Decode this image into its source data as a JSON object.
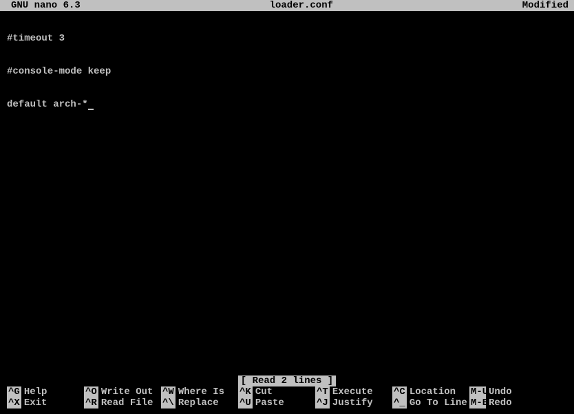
{
  "titlebar": {
    "app": "GNU nano 6.3",
    "filename": "loader.conf",
    "status": "Modified"
  },
  "editor": {
    "lines": [
      "#timeout 3",
      "#console-mode keep",
      "default arch-*"
    ]
  },
  "status": "[ Read 2 lines ]",
  "help": {
    "row1": [
      {
        "key": "^G",
        "label": "Help"
      },
      {
        "key": "^O",
        "label": "Write Out"
      },
      {
        "key": "^W",
        "label": "Where Is"
      },
      {
        "key": "^K",
        "label": "Cut"
      },
      {
        "key": "^T",
        "label": "Execute"
      },
      {
        "key": "^C",
        "label": "Location"
      },
      {
        "key": "M-U",
        "label": "Undo"
      }
    ],
    "row2": [
      {
        "key": "^X",
        "label": "Exit"
      },
      {
        "key": "^R",
        "label": "Read File"
      },
      {
        "key": "^\\",
        "label": "Replace"
      },
      {
        "key": "^U",
        "label": "Paste"
      },
      {
        "key": "^J",
        "label": "Justify"
      },
      {
        "key": "^_",
        "label": "Go To Line"
      },
      {
        "key": "M-E",
        "label": "Redo"
      }
    ]
  }
}
